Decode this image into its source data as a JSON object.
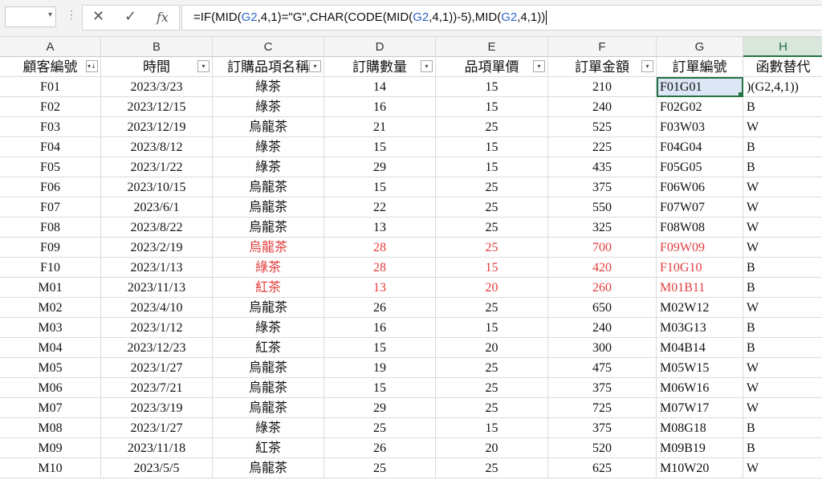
{
  "formula_bar": {
    "parts": [
      {
        "t": "=IF(MID(",
        "ref": false
      },
      {
        "t": "G2",
        "ref": true
      },
      {
        "t": ",4,1)=\"G\",CHAR(CODE(MID(",
        "ref": false
      },
      {
        "t": "G2",
        "ref": true
      },
      {
        "t": ",4,1))-5),MID(",
        "ref": false
      },
      {
        "t": "G2",
        "ref": true
      },
      {
        "t": ",4,1))",
        "ref": false
      }
    ],
    "cancel_icon": "✕",
    "enter_icon": "✓",
    "fx_label": "fx",
    "dots": "⋮",
    "dropdown": "▾"
  },
  "columns": [
    "A",
    "B",
    "C",
    "D",
    "E",
    "F",
    "G",
    "H"
  ],
  "selected_column": "H",
  "headers": [
    "顧客編號",
    "時間",
    "訂購品項名稱",
    "訂購數量",
    "品項單價",
    "訂單金額",
    "訂單編號",
    "函數替代"
  ],
  "filter_icons": [
    "▾↓",
    "▾",
    "▾",
    "▾",
    "▾",
    "▾"
  ],
  "active_cell_text": ")(G2,4,1))",
  "rows": [
    {
      "a": "F01",
      "b": "2023/3/23",
      "c": "綠茶",
      "d": "14",
      "e": "15",
      "f": "210",
      "g": "F01G01",
      "h": "",
      "red": false
    },
    {
      "a": "F02",
      "b": "2023/12/15",
      "c": "綠茶",
      "d": "16",
      "e": "15",
      "f": "240",
      "g": "F02G02",
      "h": "B",
      "red": false
    },
    {
      "a": "F03",
      "b": "2023/12/19",
      "c": "烏龍茶",
      "d": "21",
      "e": "25",
      "f": "525",
      "g": "F03W03",
      "h": "W",
      "red": false
    },
    {
      "a": "F04",
      "b": "2023/8/12",
      "c": "綠茶",
      "d": "15",
      "e": "15",
      "f": "225",
      "g": "F04G04",
      "h": "B",
      "red": false
    },
    {
      "a": "F05",
      "b": "2023/1/22",
      "c": "綠茶",
      "d": "29",
      "e": "15",
      "f": "435",
      "g": "F05G05",
      "h": "B",
      "red": false
    },
    {
      "a": "F06",
      "b": "2023/10/15",
      "c": "烏龍茶",
      "d": "15",
      "e": "25",
      "f": "375",
      "g": "F06W06",
      "h": "W",
      "red": false
    },
    {
      "a": "F07",
      "b": "2023/6/1",
      "c": "烏龍茶",
      "d": "22",
      "e": "25",
      "f": "550",
      "g": "F07W07",
      "h": "W",
      "red": false
    },
    {
      "a": "F08",
      "b": "2023/8/22",
      "c": "烏龍茶",
      "d": "13",
      "e": "25",
      "f": "325",
      "g": "F08W08",
      "h": "W",
      "red": false
    },
    {
      "a": "F09",
      "b": "2023/2/19",
      "c": "烏龍茶",
      "d": "28",
      "e": "25",
      "f": "700",
      "g": "F09W09",
      "h": "W",
      "red": true
    },
    {
      "a": "F10",
      "b": "2023/1/13",
      "c": "綠茶",
      "d": "28",
      "e": "15",
      "f": "420",
      "g": "F10G10",
      "h": "B",
      "red": true
    },
    {
      "a": "M01",
      "b": "2023/11/13",
      "c": "紅茶",
      "d": "13",
      "e": "20",
      "f": "260",
      "g": "M01B11",
      "h": "B",
      "red": true
    },
    {
      "a": "M02",
      "b": "2023/4/10",
      "c": "烏龍茶",
      "d": "26",
      "e": "25",
      "f": "650",
      "g": "M02W12",
      "h": "W",
      "red": false
    },
    {
      "a": "M03",
      "b": "2023/1/12",
      "c": "綠茶",
      "d": "16",
      "e": "15",
      "f": "240",
      "g": "M03G13",
      "h": "B",
      "red": false
    },
    {
      "a": "M04",
      "b": "2023/12/23",
      "c": "紅茶",
      "d": "15",
      "e": "20",
      "f": "300",
      "g": "M04B14",
      "h": "B",
      "red": false
    },
    {
      "a": "M05",
      "b": "2023/1/27",
      "c": "烏龍茶",
      "d": "19",
      "e": "25",
      "f": "475",
      "g": "M05W15",
      "h": "W",
      "red": false
    },
    {
      "a": "M06",
      "b": "2023/7/21",
      "c": "烏龍茶",
      "d": "15",
      "e": "25",
      "f": "375",
      "g": "M06W16",
      "h": "W",
      "red": false
    },
    {
      "a": "M07",
      "b": "2023/3/19",
      "c": "烏龍茶",
      "d": "29",
      "e": "25",
      "f": "725",
      "g": "M07W17",
      "h": "W",
      "red": false
    },
    {
      "a": "M08",
      "b": "2023/1/27",
      "c": "綠茶",
      "d": "25",
      "e": "15",
      "f": "375",
      "g": "M08G18",
      "h": "B",
      "red": false
    },
    {
      "a": "M09",
      "b": "2023/11/18",
      "c": "紅茶",
      "d": "26",
      "e": "20",
      "f": "520",
      "g": "M09B19",
      "h": "B",
      "red": false
    },
    {
      "a": "M10",
      "b": "2023/5/5",
      "c": "烏龍茶",
      "d": "25",
      "e": "25",
      "f": "625",
      "g": "M10W20",
      "h": "W",
      "red": false
    }
  ],
  "colors": {
    "accent": "#217346",
    "reference": "#2f65c4",
    "highlight_text": "#e23c3c"
  }
}
